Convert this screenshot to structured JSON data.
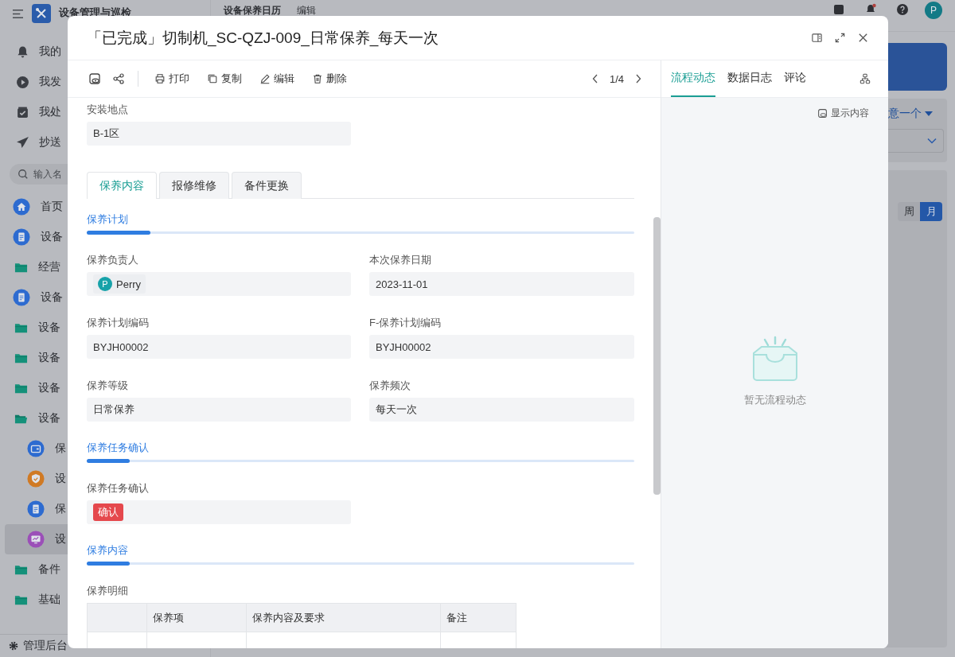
{
  "app": {
    "title": "设备管理与巡检",
    "page": "设备保养日历",
    "page_action": "编辑",
    "avatar": "P"
  },
  "sidebar": {
    "shortcuts": [
      {
        "label": "我的",
        "kind": "bell"
      },
      {
        "label": "我发",
        "kind": "play"
      },
      {
        "label": "我处",
        "kind": "task"
      },
      {
        "label": "抄送",
        "kind": "send"
      }
    ],
    "search": {
      "placeholder": "输入名"
    },
    "menu": [
      {
        "label": "首页",
        "kind": "home",
        "selected": false
      },
      {
        "label": "设备",
        "kind": "doc",
        "selected": false
      },
      {
        "label": "经营",
        "kind": "folder",
        "selected": false,
        "expanded": false
      },
      {
        "label": "设备",
        "kind": "doc",
        "selected": false
      },
      {
        "label": "设备",
        "kind": "folder",
        "selected": false,
        "expanded": false
      },
      {
        "label": "设备",
        "kind": "folder",
        "selected": false,
        "expanded": false
      },
      {
        "label": "设备",
        "kind": "folder",
        "selected": false,
        "expanded": false
      },
      {
        "label": "设备",
        "kind": "folder",
        "selected": false,
        "expanded": true,
        "children": [
          {
            "label": "保",
            "kind": "wallet",
            "selected": false
          },
          {
            "label": "设",
            "kind": "shield",
            "selected": false
          },
          {
            "label": "保",
            "kind": "doc",
            "selected": false
          },
          {
            "label": "设",
            "kind": "monitor",
            "selected": true
          }
        ]
      },
      {
        "label": "备件",
        "kind": "folder",
        "selected": false,
        "expanded": false
      },
      {
        "label": "基础",
        "kind": "folder",
        "selected": false,
        "expanded": false
      }
    ],
    "admin": "管理后台"
  },
  "background": {
    "filter": "意一个",
    "views": [
      {
        "label": "周",
        "selected": false
      },
      {
        "label": "月",
        "selected": true
      }
    ]
  },
  "dialog": {
    "title": "「已完成」切制机_SC-QZJ-009_日常保养_每天一次",
    "actions": [
      {
        "label": "打印",
        "kind": "print"
      },
      {
        "label": "复制",
        "kind": "copy"
      },
      {
        "label": "编辑",
        "kind": "edit"
      },
      {
        "label": "删除",
        "kind": "delete"
      }
    ],
    "pager": "1/4",
    "top_field": {
      "label": "安装地点",
      "value": "B-1区"
    },
    "tabs": [
      {
        "label": "保养内容",
        "selected": true
      },
      {
        "label": "报修维修",
        "selected": false
      },
      {
        "label": "备件更换",
        "selected": false
      }
    ],
    "sections": [
      {
        "title": "保养计划",
        "fields": [
          {
            "label": "保养负责人",
            "kind": "person",
            "avatar": "P",
            "value": "Perry"
          },
          {
            "label": "本次保养日期",
            "kind": "text",
            "value": "2023-11-01"
          },
          {
            "label": "保养计划编码",
            "kind": "text",
            "value": "BYJH00002"
          },
          {
            "label": "F-保养计划编码",
            "kind": "text",
            "value": "BYJH00002"
          },
          {
            "label": "保养等级",
            "kind": "text",
            "value": "日常保养"
          },
          {
            "label": "保养频次",
            "kind": "text",
            "value": "每天一次"
          }
        ]
      },
      {
        "title": "保养任务确认",
        "fields": [
          {
            "label": "保养任务确认",
            "kind": "tag",
            "value": "确认"
          }
        ]
      },
      {
        "title": "保养内容",
        "table": {
          "label": "保养明细",
          "columns": [
            "保养项",
            "保养内容及要求",
            "备注"
          ]
        }
      }
    ],
    "side_tabs": [
      {
        "label": "流程动态",
        "selected": true
      },
      {
        "label": "数据日志",
        "selected": false
      },
      {
        "label": "评论",
        "selected": false
      }
    ],
    "show_content": "显示内容",
    "empty_text": "暂无流程动态"
  }
}
